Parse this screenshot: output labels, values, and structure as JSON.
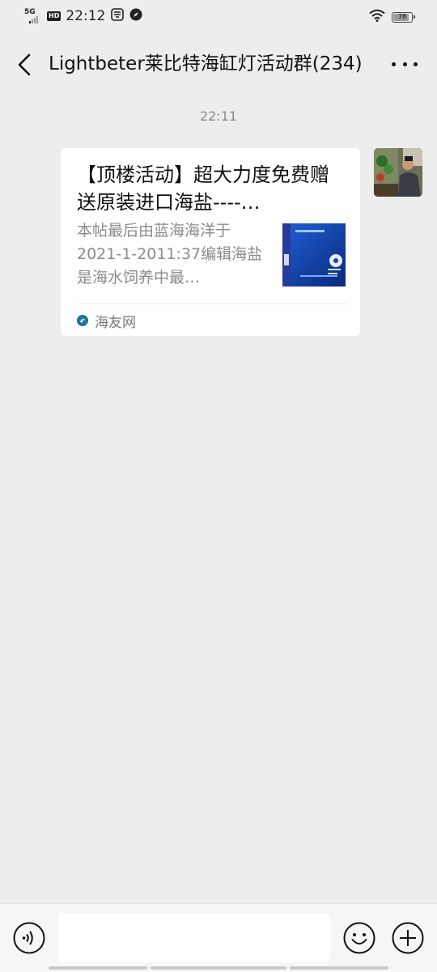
{
  "status_bar": {
    "network": "5G",
    "hd_badge": "HD",
    "time": "22:12",
    "battery_level": "78"
  },
  "header": {
    "title": "Lightbeter莱比特海缸灯活动群(234)"
  },
  "chat": {
    "timestamp": "22:11",
    "message": {
      "title": "【顶楼活动】超大力度免费赠送原装进口海盐----…",
      "description": "本帖最后由蓝海海洋于2021-1-2011:37编辑海盐是海水饲养中最…",
      "source": "海友网"
    }
  },
  "input": {
    "placeholder": ""
  },
  "colors": {
    "background": "#ededed",
    "card": "#ffffff",
    "muted_text": "#8b8b8b"
  }
}
